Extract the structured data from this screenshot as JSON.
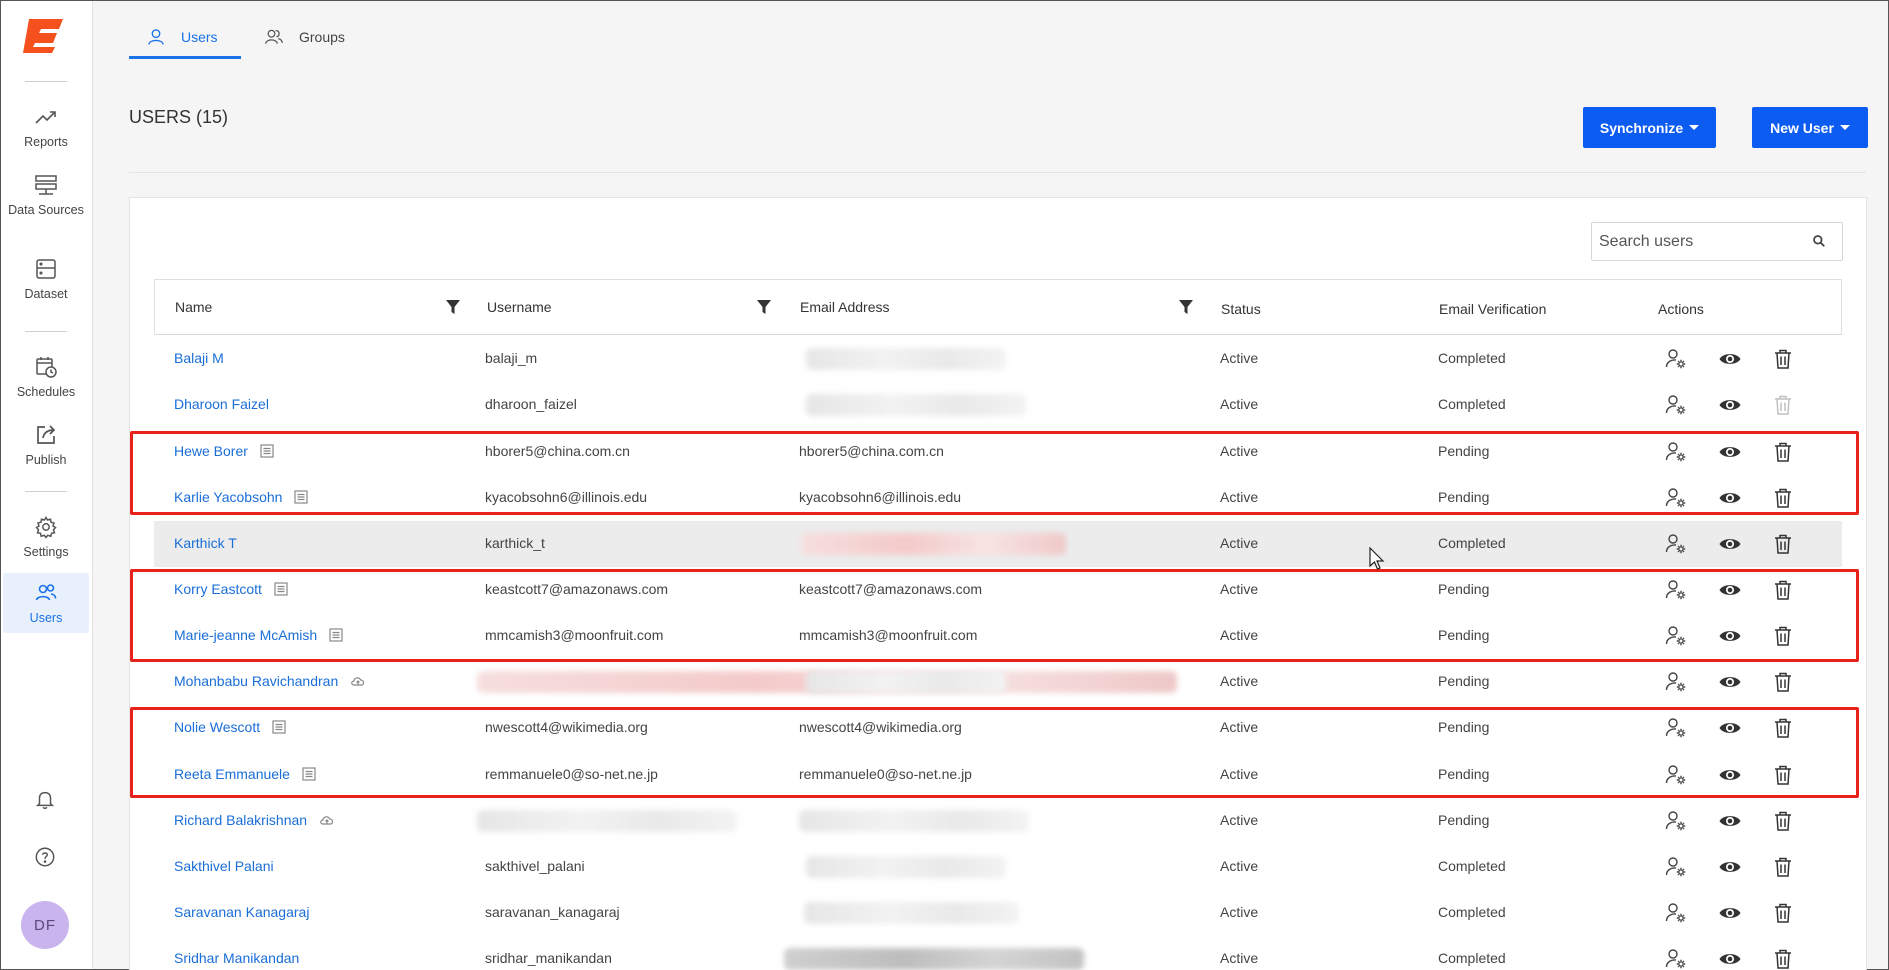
{
  "sidebar": {
    "items": [
      {
        "label": "Reports",
        "icon": "trend-icon"
      },
      {
        "label": "Data Sources",
        "icon": "server-icon"
      },
      {
        "label": "Dataset",
        "icon": "dataset-icon"
      },
      {
        "label": "Schedules",
        "icon": "calendar-clock-icon"
      },
      {
        "label": "Publish",
        "icon": "publish-icon"
      },
      {
        "label": "Settings",
        "icon": "gear-icon"
      },
      {
        "label": "Users",
        "icon": "users-icon",
        "active": true
      }
    ],
    "avatar_initials": "DF"
  },
  "tabs": [
    {
      "label": "Users",
      "active": true
    },
    {
      "label": "Groups",
      "active": false
    }
  ],
  "header": {
    "title": "USERS (15)",
    "synchronize_label": "Synchronize",
    "new_user_label": "New User"
  },
  "search": {
    "placeholder": "Search users"
  },
  "table": {
    "columns": [
      "Name",
      "Username",
      "Email Address",
      "Status",
      "Email Verification",
      "Actions"
    ],
    "rows": [
      {
        "name": "Balaji M",
        "username": "balaji_m",
        "email": "",
        "status": "Active",
        "verification": "Completed"
      },
      {
        "name": "Dharoon Faizel",
        "username": "dharoon_faizel",
        "email": "",
        "status": "Active",
        "verification": "Completed"
      },
      {
        "name": "Hewe Borer",
        "username": "hborer5@china.com.cn",
        "email": "hborer5@china.com.cn",
        "status": "Active",
        "verification": "Pending"
      },
      {
        "name": "Karlie Yacobsohn",
        "username": "kyacobsohn6@illinois.edu",
        "email": "kyacobsohn6@illinois.edu",
        "status": "Active",
        "verification": "Pending"
      },
      {
        "name": "Karthick T",
        "username": "karthick_t",
        "email": "",
        "status": "Active",
        "verification": "Completed"
      },
      {
        "name": "Korry Eastcott",
        "username": "keastcott7@amazonaws.com",
        "email": "keastcott7@amazonaws.com",
        "status": "Active",
        "verification": "Pending"
      },
      {
        "name": "Marie-jeanne McAmish",
        "username": "mmcamish3@moonfruit.com",
        "email": "mmcamish3@moonfruit.com",
        "status": "Active",
        "verification": "Pending"
      },
      {
        "name": "Mohanbabu Ravichandran",
        "username": "",
        "email": "",
        "status": "Active",
        "verification": "Pending"
      },
      {
        "name": "Nolie Wescott",
        "username": "nwescott4@wikimedia.org",
        "email": "nwescott4@wikimedia.org",
        "status": "Active",
        "verification": "Pending"
      },
      {
        "name": "Reeta Emmanuele",
        "username": "remmanuele0@so-net.ne.jp",
        "email": "remmanuele0@so-net.ne.jp",
        "status": "Active",
        "verification": "Pending"
      },
      {
        "name": "Richard Balakrishnan",
        "username": "",
        "email": "",
        "status": "Active",
        "verification": "Pending"
      },
      {
        "name": "Sakthivel Palani",
        "username": "sakthivel_palani",
        "email": "",
        "status": "Active",
        "verification": "Completed"
      },
      {
        "name": "Saravanan Kanagaraj",
        "username": "saravanan_kanagaraj",
        "email": "",
        "status": "Active",
        "verification": "Completed"
      },
      {
        "name": "Sridhar Manikandan",
        "username": "sridhar_manikandan",
        "email": "",
        "status": "Active",
        "verification": "Completed"
      }
    ]
  },
  "colors": {
    "accent": "#1a73e8",
    "button": "#0d5cf2",
    "highlight_box": "#e8211a",
    "logo": "#f4511e"
  }
}
